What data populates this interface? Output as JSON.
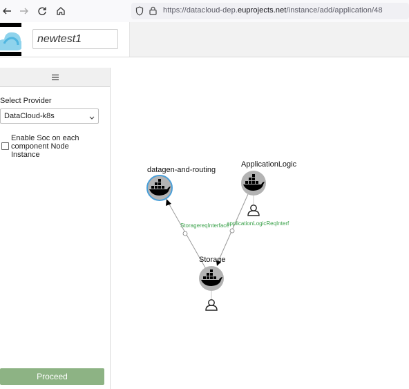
{
  "browser": {
    "url_prefix": "https://datacloud-dep.",
    "url_domain": "euprojects.net",
    "url_path": "/instance/add/application/48",
    "icons": [
      "back-arrow-icon",
      "forward-arrow-icon",
      "reload-icon",
      "home-icon",
      "shield-icon",
      "lock-icon"
    ]
  },
  "header": {
    "app_name": "newtest1"
  },
  "sidebar": {
    "menu_icon": "hamburger-icon",
    "provider_label": "Select Provider",
    "provider_value": "DataCloud-k8s",
    "soc_label": "Enable Soc on each component Node Instance",
    "soc_checked": false,
    "proceed_label": "Proceed"
  },
  "graph": {
    "nodes": [
      {
        "id": "datagen",
        "label": "datagen-and-routing",
        "selected": true,
        "has_user": false
      },
      {
        "id": "applogic",
        "label": "ApplicationLogic",
        "selected": false,
        "has_user": true
      },
      {
        "id": "storage",
        "label": "Storage",
        "selected": false,
        "has_user": true
      }
    ],
    "edges": [
      {
        "from": "storage",
        "to": "datagen",
        "label": "StoragereqInterface"
      },
      {
        "from": "applogic",
        "to": "storage",
        "label": "applicationLogicReqInterf"
      }
    ],
    "colors": {
      "node_fill": "#b3b3b3",
      "selected_ring": "#4a9fd8",
      "edge_line": "#9a9a9a",
      "edge_label": "#3aa14a",
      "proceed_bg": "#8db384"
    }
  }
}
